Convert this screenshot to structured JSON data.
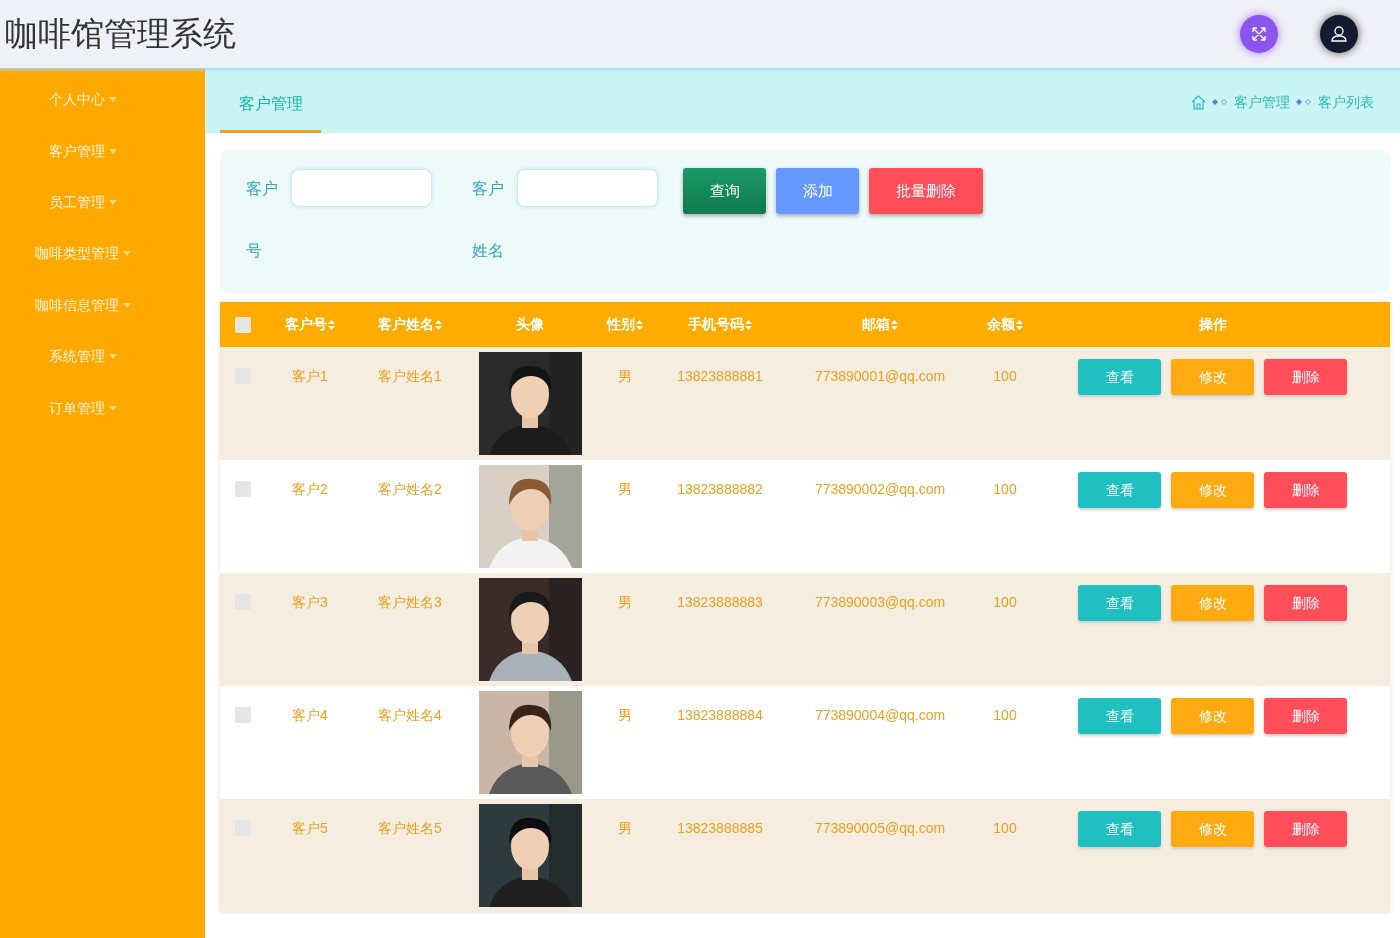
{
  "header": {
    "title": "咖啡馆管理系统"
  },
  "sidebar": {
    "items": [
      {
        "label": "个人中心"
      },
      {
        "label": "客户管理"
      },
      {
        "label": "员工管理"
      },
      {
        "label": "咖啡类型管理"
      },
      {
        "label": "咖啡信息管理"
      },
      {
        "label": "系统管理"
      },
      {
        "label": "订单管理"
      }
    ]
  },
  "tab": {
    "label": "客户管理"
  },
  "breadcrumb": [
    "客户管理",
    "客户列表"
  ],
  "search": {
    "fields": [
      {
        "label": "客户号"
      },
      {
        "label": "客户姓名"
      }
    ],
    "buttons": [
      {
        "kind": "query",
        "label": "查询"
      },
      {
        "kind": "add",
        "label": "添加"
      },
      {
        "kind": "delete",
        "label": "批量删除"
      }
    ]
  },
  "table": {
    "select_all": {
      "checked": false
    },
    "columns": [
      {
        "label": "客户号",
        "sortable": true
      },
      {
        "label": "客户姓名",
        "sortable": true
      },
      {
        "label": "头像",
        "sortable": false
      },
      {
        "label": "性别",
        "sortable": true
      },
      {
        "label": "手机号码",
        "sortable": true
      },
      {
        "label": "邮箱",
        "sortable": true
      },
      {
        "label": "余额",
        "sortable": true
      },
      {
        "label": "操作",
        "sortable": false
      }
    ],
    "rows": [
      {
        "checked": false,
        "id": "客户1",
        "name": "客户姓名1",
        "sex": "男",
        "phone": "13823888881",
        "email": "773890001@qq.com",
        "balance": "100",
        "actions": [
          "查看",
          "修改",
          "删除"
        ]
      },
      {
        "checked": false,
        "id": "客户2",
        "name": "客户姓名2",
        "sex": "男",
        "phone": "13823888882",
        "email": "773890002@qq.com",
        "balance": "100",
        "actions": [
          "查看",
          "修改",
          "删除"
        ]
      },
      {
        "checked": false,
        "id": "客户3",
        "name": "客户姓名3",
        "sex": "男",
        "phone": "13823888883",
        "email": "773890003@qq.com",
        "balance": "100",
        "actions": [
          "查看",
          "修改",
          "删除"
        ]
      },
      {
        "checked": false,
        "id": "客户4",
        "name": "客户姓名4",
        "sex": "男",
        "phone": "13823888884",
        "email": "773890004@qq.com",
        "balance": "100",
        "actions": [
          "查看",
          "修改",
          "删除"
        ]
      },
      {
        "checked": false,
        "id": "客户5",
        "name": "客户姓名5",
        "sex": "男",
        "phone": "13823888885",
        "email": "773890005@qq.com",
        "balance": "100",
        "actions": [
          "查看",
          "修改",
          "删除"
        ]
      }
    ]
  }
}
